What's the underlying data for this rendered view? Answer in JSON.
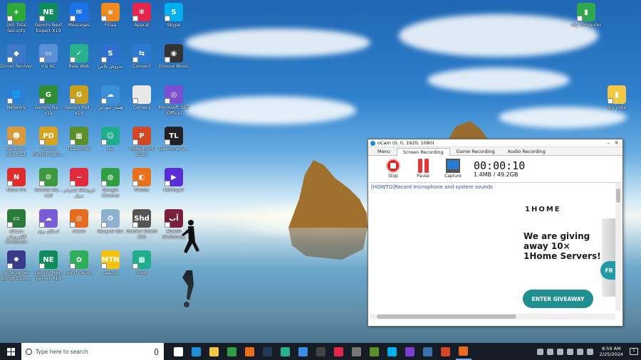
{
  "desktop": {
    "icons": [
      {
        "label": "360 Total Security",
        "icon": "360-security-icon",
        "color": "#2fa83a",
        "glyph": "+"
      },
      {
        "label": "Gemini Next Expert X19",
        "icon": "gemini-next-icon",
        "color": "#0f8c5c",
        "glyph": "NE"
      },
      {
        "label": "Messages",
        "icon": "messages-icon",
        "color": "#1a73e8",
        "glyph": "✉"
      },
      {
        "label": "Fiilaa",
        "icon": "fiilaa-icon",
        "color": "#f08a1e",
        "glyph": "e"
      },
      {
        "label": "Aparat",
        "icon": "aparat-icon",
        "color": "#e2264d",
        "glyph": "✻"
      },
      {
        "label": "Skype",
        "icon": "skype-icon",
        "color": "#00aff0",
        "glyph": "S"
      },
      {
        "label": "Driver Reviver",
        "icon": "driver-reviver-icon",
        "color": "#3d78c9",
        "glyph": "◆"
      },
      {
        "label": "Iris AC",
        "icon": "iris-icon",
        "color": "#5a8fd8",
        "glyph": "▭"
      },
      {
        "label": "Bale Web",
        "icon": "bale-icon",
        "color": "#27b28d",
        "glyph": "✓"
      },
      {
        "label": "سروش پلاس",
        "icon": "soroush-icon",
        "color": "#2f6fcf",
        "glyph": "S"
      },
      {
        "label": "Connect",
        "icon": "connect-icon",
        "color": "#2a7ad1",
        "glyph": "⇆"
      },
      {
        "label": "Groove Music",
        "icon": "groove-music-icon",
        "color": "#333333",
        "glyph": "◉"
      },
      {
        "label": "Network",
        "icon": "network-icon",
        "color": "#2c7fd4",
        "glyph": "🌐"
      },
      {
        "label": "Gemini Ne... x19",
        "icon": "gemini-icon",
        "color": "#2f8c2f",
        "glyph": "G"
      },
      {
        "label": "Gemini Pell... x19",
        "icon": "gemini-pell-icon",
        "color": "#c8a11c",
        "glyph": "G"
      },
      {
        "label": "همیار آموزش",
        "icon": "hamyar-icon",
        "color": "#3b8fd9",
        "glyph": "☁"
      },
      {
        "label": "Camera",
        "icon": "camera-file-icon",
        "color": "#e8e8e8",
        "glyph": ""
      },
      {
        "label": "Microsoft 365 (Office)",
        "icon": "office-icon",
        "color": "#7a4fd1",
        "glyph": "◎"
      },
      {
        "label": "Ransom - Shortcut",
        "icon": "user-icon",
        "color": "#d89a3b",
        "glyph": "☻"
      },
      {
        "label": "Gemini Pattern Desi...",
        "icon": "gemini-pattern-icon",
        "color": "#d8a21c",
        "glyph": "PD"
      },
      {
        "label": "TLauncher",
        "icon": "tlauncher-icon",
        "color": "#5a8f2a",
        "glyph": "▦"
      },
      {
        "label": "شاد",
        "icon": "shad-icon",
        "color": "#1fae8d",
        "glyph": "☺"
      },
      {
        "label": "PowerPoint 2016",
        "icon": "powerpoint-icon",
        "color": "#d24726",
        "glyph": "P"
      },
      {
        "label": "TLauncher 2...",
        "icon": "tlauncher2-icon",
        "color": "#222222",
        "glyph": "TL"
      },
      {
        "label": "Nitro Pro",
        "icon": "nitro-icon",
        "color": "#e02b2b",
        "glyph": "N"
      },
      {
        "label": "Gemini Ne... x19",
        "icon": "gemini-gear-icon",
        "color": "#3c9a3c",
        "glyph": "⚙"
      },
      {
        "label": "فروشگاه اینترنتی دیوار",
        "icon": "divar-icon",
        "color": "#e02b3c",
        "glyph": "~"
      },
      {
        "label": "Google Chrome",
        "icon": "chrome-icon",
        "color": "#2f9e44",
        "glyph": "◍"
      },
      {
        "label": "Firefox",
        "icon": "firefox-icon",
        "color": "#e8701a",
        "glyph": "◐"
      },
      {
        "label": "KMPlayer",
        "icon": "kmplayer-icon",
        "color": "#5b2bd6",
        "glyph": "▶"
      },
      {
        "label": "دانشگاه الکترونیکی Computer",
        "icon": "computer-icon",
        "color": "#2a7a3a",
        "glyph": "▭"
      },
      {
        "label": "اسکای روم",
        "icon": "skyroom-icon",
        "color": "#7a5bd8",
        "glyph": "☁"
      },
      {
        "label": "oCam",
        "icon": "ocam-icon",
        "color": "#e86a1e",
        "glyph": "◎"
      },
      {
        "label": "Recycle Bin",
        "icon": "recycle-bin-icon",
        "color": "#8fb0d0",
        "glyph": "♻"
      },
      {
        "label": "Gemini Shield X20",
        "icon": "gemini-shield-icon",
        "color": "#555555",
        "glyph": "Shd"
      },
      {
        "label": "Abadis Dictionary",
        "icon": "abadis-icon",
        "color": "#7b1f3a",
        "glyph": "آب"
      },
      {
        "label": "NoteGames Bomb Squa...",
        "icon": "bomb-squad-icon",
        "color": "#3a3a8a",
        "glyph": "✸"
      },
      {
        "label": "Gemini Next Server X19",
        "icon": "gemini-server-icon",
        "color": "#0f8c5c",
        "glyph": "NE"
      },
      {
        "label": "sport-ravati",
        "icon": "sport-icon",
        "color": "#2fae5a",
        "glyph": "✿"
      },
      {
        "label": "ایرانسل",
        "icon": "irancell-icon",
        "color": "#f4c20d",
        "glyph": "MTN"
      },
      {
        "label": "Shad",
        "icon": "shad2-icon",
        "color": "#1fae8d",
        "glyph": "▦"
      },
      {
        "label": "my computer",
        "icon": "folder-icon",
        "color": "#2fa84f",
        "glyph": "▮"
      },
      {
        "label": "my vidio",
        "icon": "folder-icon",
        "color": "#f2c744",
        "glyph": "▮"
      }
    ]
  },
  "ocam": {
    "title": "oCam (0, 0, 1920, 1080)",
    "tabs": [
      "Menu",
      "Screen Recording",
      "Game Recording",
      "Audio Recording"
    ],
    "active_tab": "Screen Recording",
    "toolbar": {
      "stop": "Stop",
      "pause": "Pause",
      "capture": "Capture"
    },
    "timer": "00:00:10",
    "storage": "1.4MB / 49.2GB",
    "howto": "[HOWTO]Record microphone and system sounds",
    "ad": {
      "logo": "1HOME",
      "headline": "We are giving away 10× 1Home Servers!",
      "button": "ENTER GIVEAWAY",
      "badge": "FR"
    }
  },
  "taskbar": {
    "search_placeholder": "Type here to search",
    "time": "8:59 AM",
    "date": "2/25/2024",
    "notifications": "1",
    "apps": [
      {
        "name": "task-view-icon",
        "color": "#ffffff"
      },
      {
        "name": "edge-icon",
        "color": "#1f8fd6"
      },
      {
        "name": "file-explorer-icon",
        "color": "#f2c744"
      },
      {
        "name": "chrome-icon",
        "color": "#2f9e44"
      },
      {
        "name": "firefox-icon",
        "color": "#e8701a"
      },
      {
        "name": "photoshop-icon",
        "color": "#1f3b57"
      },
      {
        "name": "bale-icon",
        "color": "#27b28d"
      },
      {
        "name": "calculator-icon",
        "color": "#3a8ee6"
      },
      {
        "name": "camera-icon",
        "color": "#444444"
      },
      {
        "name": "aparat-icon",
        "color": "#e2264d"
      },
      {
        "name": "settings-icon",
        "color": "#777777"
      },
      {
        "name": "minecraft-icon",
        "color": "#5a8f2a"
      },
      {
        "name": "skype-icon",
        "color": "#00aff0"
      },
      {
        "name": "paint-icon",
        "color": "#7a3fd1"
      },
      {
        "name": "network-icon",
        "color": "#3a6fb0"
      },
      {
        "name": "powerpoint-icon",
        "color": "#d24726"
      },
      {
        "name": "ocam-icon",
        "color": "#e86a1e"
      }
    ]
  }
}
